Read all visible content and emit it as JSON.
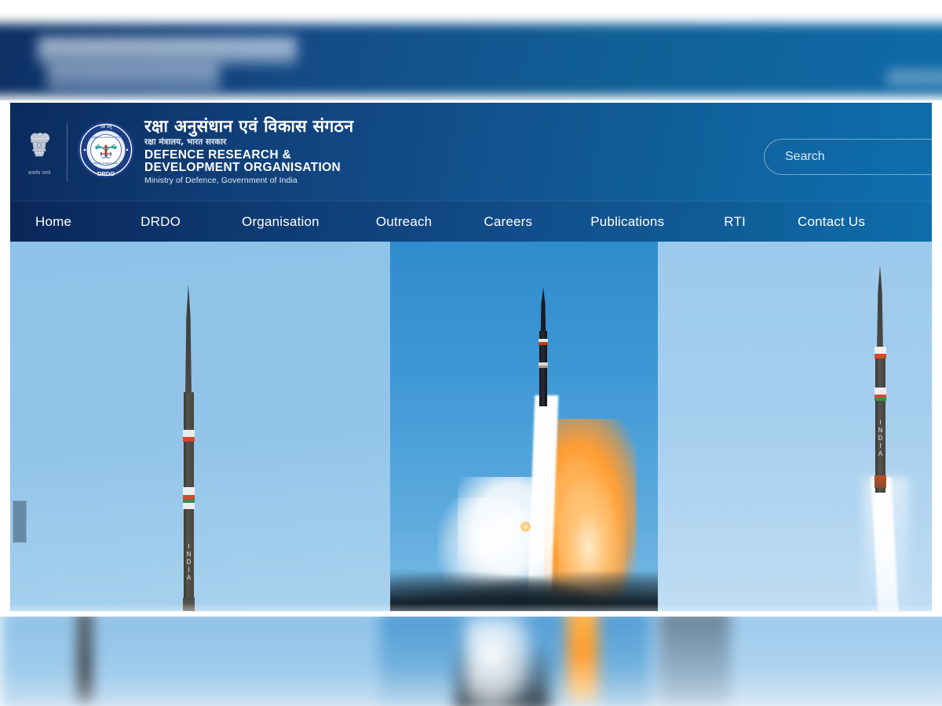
{
  "site": {
    "emblem_motto": "सत्यमेव जयते",
    "logo_text": "DRDO",
    "title_hindi_main": "रक्षा अनुसंधान एवं विकास संगठन",
    "title_hindi_sub": "रक्षा मंत्रालय, भारत सरकार",
    "title_english_line1": "DEFENCE RESEARCH &",
    "title_english_line2": "DEVELOPMENT ORGANISATION",
    "ministry_line": "Ministry of Defence, Government of India"
  },
  "search": {
    "placeholder": "Search",
    "value": ""
  },
  "nav": {
    "items": [
      {
        "label": "Home"
      },
      {
        "label": "DRDO"
      },
      {
        "label": "Organisation"
      },
      {
        "label": "Outreach"
      },
      {
        "label": "Careers"
      },
      {
        "label": "Publications"
      },
      {
        "label": "RTI"
      },
      {
        "label": "Contact Us"
      }
    ]
  },
  "hero": {
    "slides": [
      {
        "caption": "",
        "rocket_label": "INDIA"
      },
      {
        "caption": "",
        "rocket_label": ""
      },
      {
        "caption": "",
        "rocket_label": "INDIA"
      }
    ],
    "prev_control": "‹"
  },
  "colors": {
    "header_dark": "#0b2a5c",
    "header_light": "#0e6fae",
    "nav_dark": "#0a2658",
    "nav_light": "#0e6dab",
    "sky_light": "#8ec2e8",
    "sky_mid": "#2f8ccd",
    "flame": "#ff9c33"
  }
}
